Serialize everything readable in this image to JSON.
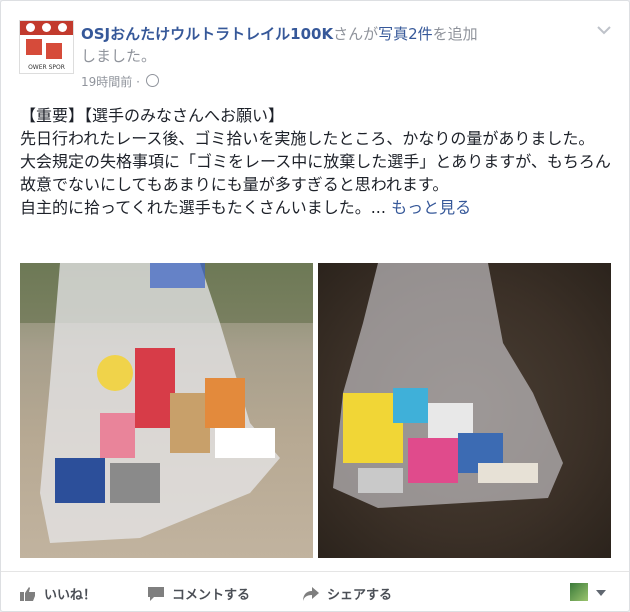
{
  "post": {
    "page_name": "OSJおんたけウルトラトレイル100K",
    "action_pre": "さんが",
    "action_link": "写真2件",
    "action_post": "を追加",
    "action_line2": "しました。",
    "timestamp": "19時間前",
    "meta_sep": " · ",
    "avatar_caption": "OWER SPOR",
    "text_lines": [
      "【重要】【選手のみなさんへお願い】",
      "先日行われたレース後、ゴミ拾いを実施したところ、かなりの量がありました。",
      "大会規定の失格事項に「ゴミをレース中に放棄した選手」とありますが、もちろん故意でないにしてもあまりにも量が多すぎると思われます。",
      "自主的に拾ってくれた選手もたくさんいました。..."
    ],
    "see_more": "もっと見る"
  },
  "actions": {
    "like": "いいね！",
    "comment": "コメントする",
    "share": "シェアする"
  },
  "colors": {
    "link": "#365899",
    "text": "#1d2129",
    "muted": "#90949c"
  }
}
